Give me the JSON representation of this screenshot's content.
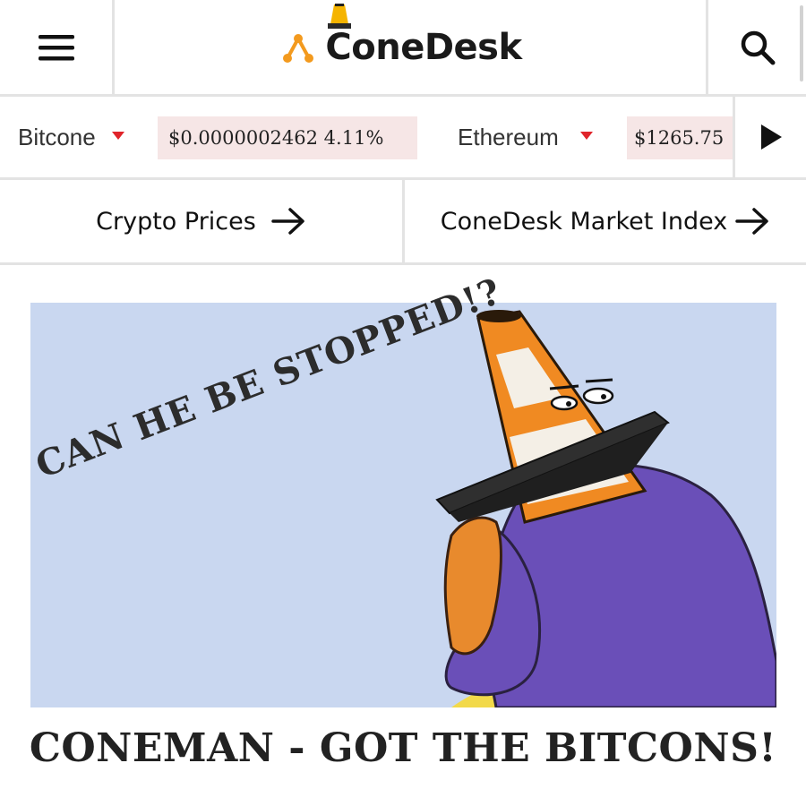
{
  "header": {
    "logo_text": "ConeDesk"
  },
  "ticker": {
    "items": [
      {
        "name": "Bitcone",
        "trend": "down",
        "price": "$0.0000002462 4.11%"
      },
      {
        "name": "Ethereum",
        "trend": "down",
        "price": "$1265.75"
      }
    ]
  },
  "nav": {
    "links": [
      {
        "label": "Crypto Prices"
      },
      {
        "label": "ConeDesk Market Index"
      }
    ]
  },
  "hero": {
    "overlay_text": "CAN HE BE STOPPED!?"
  },
  "article": {
    "headline": "CONEMAN - GOT THE BITCONS!"
  },
  "colors": {
    "accent_orange": "#f39a1e",
    "down_red": "#e0242a",
    "price_bg": "#f6e6e6",
    "hero_bg": "#c9d7f0",
    "shirt_purple": "#6a4fb8"
  }
}
